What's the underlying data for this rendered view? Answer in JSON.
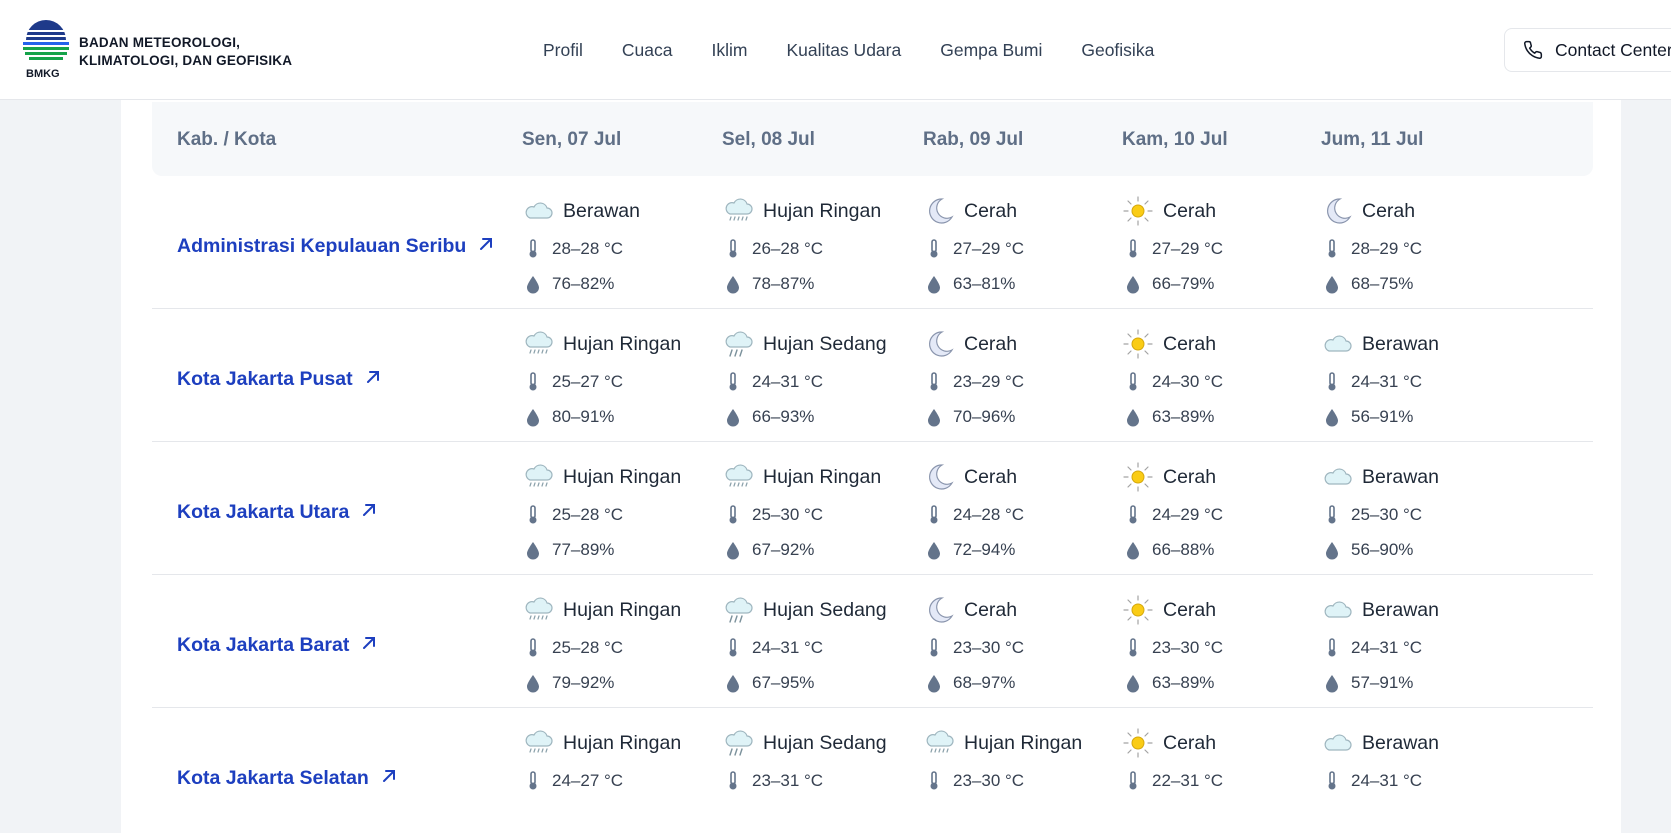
{
  "brand": {
    "name_line1": "BADAN METEOROLOGI,",
    "name_line2": "KLIMATOLOGI, DAN GEOFISIKA",
    "abbr": "BMKG"
  },
  "nav": [
    "Profil",
    "Cuaca",
    "Iklim",
    "Kualitas Udara",
    "Gempa Bumi",
    "Geofisika"
  ],
  "contact": {
    "label": "Contact Center",
    "icon": "phone-icon"
  },
  "table": {
    "header_city": "Kab. / Kota",
    "days": [
      "Sen, 07 Jul",
      "Sel, 08 Jul",
      "Rab, 09 Jul",
      "Kam, 10 Jul",
      "Jum, 11 Jul"
    ],
    "rows": [
      {
        "city": "Administrasi Kepulauan Seribu",
        "forecast": [
          {
            "icon": "cloud-icon",
            "label": "Berawan",
            "temp": "28–28 °C",
            "humidity": "76–82%"
          },
          {
            "icon": "light-rain-icon",
            "label": "Hujan Ringan",
            "temp": "26–28 °C",
            "humidity": "78–87%"
          },
          {
            "icon": "moon-icon",
            "label": "Cerah",
            "temp": "27–29 °C",
            "humidity": "63–81%"
          },
          {
            "icon": "sun-icon",
            "label": "Cerah",
            "temp": "27–29 °C",
            "humidity": "66–79%"
          },
          {
            "icon": "moon-icon",
            "label": "Cerah",
            "temp": "28–29 °C",
            "humidity": "68–75%"
          }
        ]
      },
      {
        "city": "Kota Jakarta Pusat",
        "forecast": [
          {
            "icon": "light-rain-icon",
            "label": "Hujan Ringan",
            "temp": "25–27 °C",
            "humidity": "80–91%"
          },
          {
            "icon": "moderate-rain-icon",
            "label": "Hujan Sedang",
            "temp": "24–31 °C",
            "humidity": "66–93%"
          },
          {
            "icon": "moon-icon",
            "label": "Cerah",
            "temp": "23–29 °C",
            "humidity": "70–96%"
          },
          {
            "icon": "sun-icon",
            "label": "Cerah",
            "temp": "24–30 °C",
            "humidity": "63–89%"
          },
          {
            "icon": "cloud-icon",
            "label": "Berawan",
            "temp": "24–31 °C",
            "humidity": "56–91%"
          }
        ]
      },
      {
        "city": "Kota Jakarta Utara",
        "forecast": [
          {
            "icon": "light-rain-icon",
            "label": "Hujan Ringan",
            "temp": "25–28 °C",
            "humidity": "77–89%"
          },
          {
            "icon": "light-rain-icon",
            "label": "Hujan Ringan",
            "temp": "25–30 °C",
            "humidity": "67–92%"
          },
          {
            "icon": "moon-icon",
            "label": "Cerah",
            "temp": "24–28 °C",
            "humidity": "72–94%"
          },
          {
            "icon": "sun-icon",
            "label": "Cerah",
            "temp": "24–29 °C",
            "humidity": "66–88%"
          },
          {
            "icon": "cloud-icon",
            "label": "Berawan",
            "temp": "25–30 °C",
            "humidity": "56–90%"
          }
        ]
      },
      {
        "city": "Kota Jakarta Barat",
        "forecast": [
          {
            "icon": "light-rain-icon",
            "label": "Hujan Ringan",
            "temp": "25–28 °C",
            "humidity": "79–92%"
          },
          {
            "icon": "moderate-rain-icon",
            "label": "Hujan Sedang",
            "temp": "24–31 °C",
            "humidity": "67–95%"
          },
          {
            "icon": "moon-icon",
            "label": "Cerah",
            "temp": "23–30 °C",
            "humidity": "68–97%"
          },
          {
            "icon": "sun-icon",
            "label": "Cerah",
            "temp": "23–30 °C",
            "humidity": "63–89%"
          },
          {
            "icon": "cloud-icon",
            "label": "Berawan",
            "temp": "24–31 °C",
            "humidity": "57–91%"
          }
        ]
      },
      {
        "city": "Kota Jakarta Selatan",
        "forecast": [
          {
            "icon": "light-rain-icon",
            "label": "Hujan Ringan",
            "temp": "24–27 °C",
            "humidity": ""
          },
          {
            "icon": "moderate-rain-icon",
            "label": "Hujan Sedang",
            "temp": "23–31 °C",
            "humidity": ""
          },
          {
            "icon": "light-rain-icon",
            "label": "Hujan Ringan",
            "temp": "23–30 °C",
            "humidity": ""
          },
          {
            "icon": "sun-icon",
            "label": "Cerah",
            "temp": "22–31 °C",
            "humidity": ""
          },
          {
            "icon": "cloud-icon",
            "label": "Berawan",
            "temp": "24–31 °C",
            "humidity": ""
          }
        ]
      }
    ]
  },
  "colors": {
    "city_link": "#1d3fbf",
    "header_text": "#5f6f86",
    "metric_icon": "#64748b",
    "sun": "#facc15"
  }
}
